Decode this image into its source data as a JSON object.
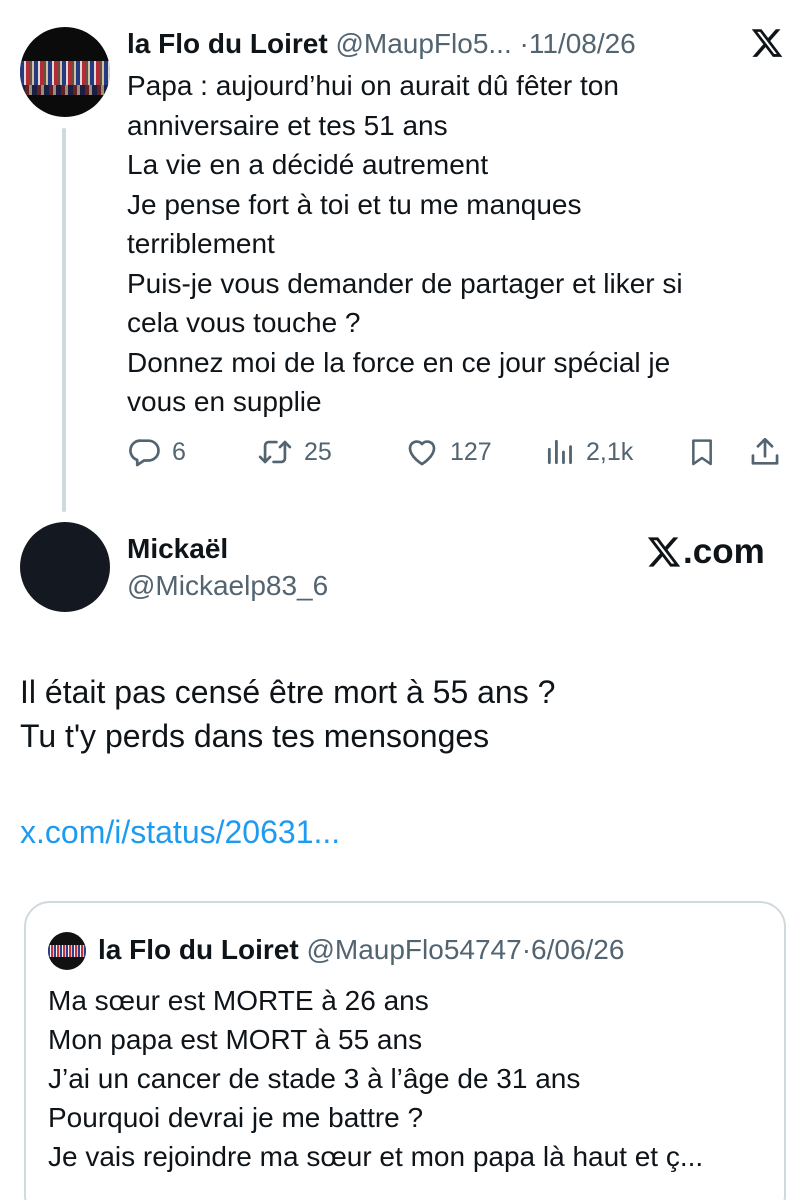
{
  "parent_tweet": {
    "display_name": "la Flo du Loiret",
    "handle": "@MaupFlo5...",
    "separator": "·",
    "date": "11/08/26",
    "lines": [
      "Papa : aujourd’hui on aurait dû fêter ton",
      "anniversaire et tes 51 ans",
      "La vie en a décidé autrement",
      "Je pense fort à toi et tu me manques",
      "terriblement",
      "Puis-je vous demander de partager et liker si",
      "cela vous touche ?",
      "Donnez moi de la force en ce jour spécial je",
      "vous en supplie"
    ],
    "stats": {
      "replies": "6",
      "reposts": "25",
      "likes": "127",
      "views": "2,1k"
    }
  },
  "quote_tweet": {
    "display_name": "Mickaël",
    "handle": "@Mickaelp83_6",
    "brand": ".com",
    "lines": [
      "Il était pas censé être mort à 55 ans ?",
      "Tu t'y perds dans tes mensonges"
    ],
    "link": "x.com/i/status/20631..."
  },
  "quoted_tweet": {
    "display_name": "la Flo du Loiret",
    "handle": "@MaupFlo54747",
    "separator": "·",
    "date": "6/06/26",
    "lines": [
      "Ma sœur est MORTE à 26 ans",
      "Mon papa est MORT à 55 ans",
      "J’ai un cancer de stade 3 à l’âge de 31 ans",
      "Pourquoi devrai je me battre ?",
      "Je vais rejoindre ma sœur et mon papa là haut et ç..."
    ]
  },
  "colors": {
    "text": "#0f1419",
    "secondary": "#536471",
    "link": "#1d9bf0",
    "border": "#cfd9de"
  },
  "icons": [
    "x-logo-icon",
    "reply-icon",
    "repost-icon",
    "like-icon",
    "views-icon",
    "bookmark-icon",
    "share-icon"
  ]
}
